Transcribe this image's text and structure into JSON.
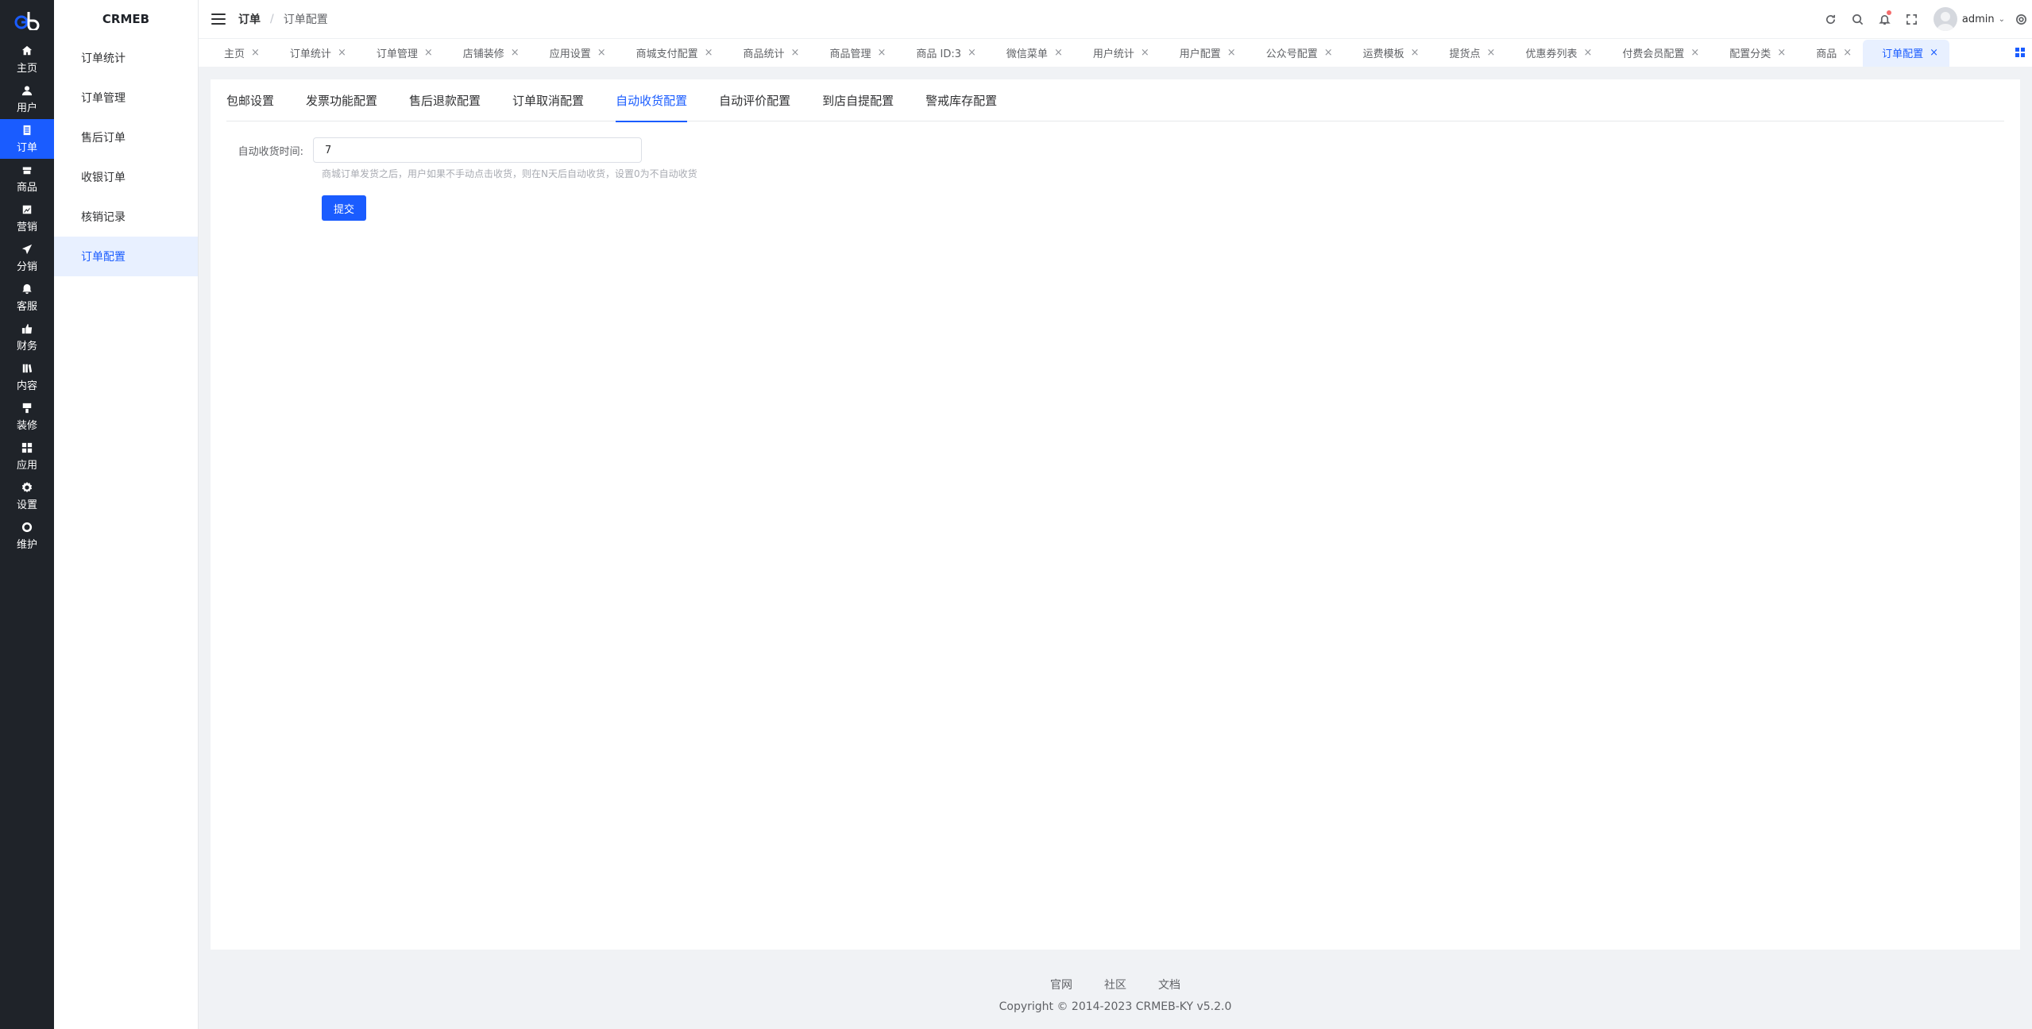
{
  "brand": "CRMEB",
  "icon_nav": [
    {
      "label": "主页",
      "icon": "home-icon"
    },
    {
      "label": "用户",
      "icon": "user-icon"
    },
    {
      "label": "订单",
      "icon": "order-icon"
    },
    {
      "label": "商品",
      "icon": "product-icon"
    },
    {
      "label": "营销",
      "icon": "marketing-icon"
    },
    {
      "label": "分销",
      "icon": "distribution-icon"
    },
    {
      "label": "客服",
      "icon": "customer-service-icon"
    },
    {
      "label": "财务",
      "icon": "finance-icon"
    },
    {
      "label": "内容",
      "icon": "content-icon"
    },
    {
      "label": "装修",
      "icon": "decoration-icon"
    },
    {
      "label": "应用",
      "icon": "apps-icon"
    },
    {
      "label": "设置",
      "icon": "settings-icon"
    },
    {
      "label": "维护",
      "icon": "maintenance-icon"
    }
  ],
  "sub_nav": [
    "订单统计",
    "订单管理",
    "售后订单",
    "收银订单",
    "核销记录",
    "订单配置"
  ],
  "breadcrumb": {
    "level1": "订单",
    "separator": "/",
    "level2": "订单配置"
  },
  "header": {
    "username": "admin"
  },
  "tabs": [
    "主页",
    "订单统计",
    "订单管理",
    "店铺装修",
    "应用设置",
    "商城支付配置",
    "商品统计",
    "商品管理",
    "商品 ID:3",
    "微信菜单",
    "用户统计",
    "用户配置",
    "公众号配置",
    "运费模板",
    "提货点",
    "优惠券列表",
    "付费会员配置",
    "配置分类",
    "商品",
    "订单配置"
  ],
  "config_tabs": [
    "包邮设置",
    "发票功能配置",
    "售后退款配置",
    "订单取消配置",
    "自动收货配置",
    "自动评价配置",
    "到店自提配置",
    "警戒库存配置"
  ],
  "form": {
    "label": "自动收货时间:",
    "value": "7",
    "tip": "商城订单发货之后，用户如果不手动点击收货，则在N天后自动收货，设置0为不自动收货",
    "submit": "提交"
  },
  "footer": {
    "links": [
      "官网",
      "社区",
      "文档"
    ],
    "copyright": "Copyright © 2014-2023 CRMEB-KY v5.2.0"
  },
  "colors": {
    "primary": "#1a5cff",
    "sidebar_bg": "#1f2329",
    "active_bg": "#e8f0ff"
  }
}
